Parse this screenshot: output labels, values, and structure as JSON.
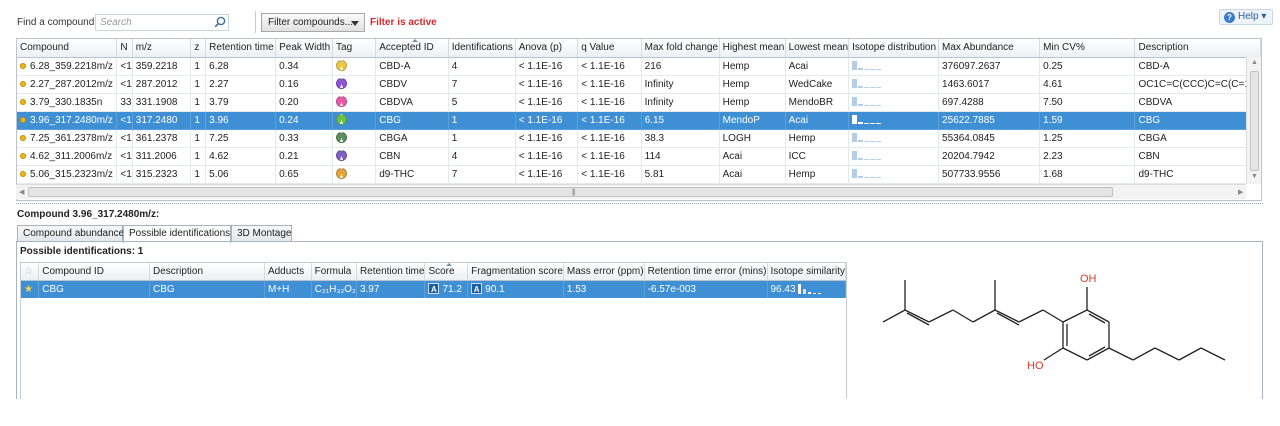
{
  "toolbar": {
    "find_label": "Find a compound:",
    "search_placeholder": "Search",
    "filter_button": "Filter compounds...",
    "filter_status": "Filter is active",
    "help": "Help"
  },
  "grid": {
    "columns": [
      "Compound",
      "N",
      "m/z",
      "z",
      "Retention time",
      "Peak Width",
      "Tag",
      "Accepted ID",
      "Identifications",
      "Anova (p)",
      "q Value",
      "Max fold change",
      "Highest mean",
      "Lowest mean",
      "Isotope distribution",
      "Max Abundance",
      "Min CV%",
      "Description"
    ],
    "rows": [
      {
        "compound": "6.28_359.2218m/z",
        "n": "<1",
        "mz": "359.2218",
        "z": "1",
        "rt": "6.28",
        "pw": "0.34",
        "tag_color": "#e9c94a",
        "accepted": "CBD-A",
        "ids": "4",
        "anova": "< 1.1E-16",
        "q": "< 1.1E-16",
        "fold": "216",
        "high": "Hemp",
        "low": "Acai",
        "maxab": "376097.2637",
        "cv": "0.25",
        "desc": "CBD-A"
      },
      {
        "compound": "2.27_287.2012m/z",
        "n": "<1",
        "mz": "287.2012",
        "z": "1",
        "rt": "2.27",
        "pw": "0.16",
        "tag_color": "#8d54d6",
        "accepted": "CBDV",
        "ids": "7",
        "anova": "< 1.1E-16",
        "q": "< 1.1E-16",
        "fold": "Infinity",
        "high": "Hemp",
        "low": "WedCake",
        "maxab": "1463.6017",
        "cv": "4.61",
        "desc": "OC1C=C(CCC)C=C(C=1[C"
      },
      {
        "compound": "3.79_330.1835n",
        "n": "33",
        "mz": "331.1908",
        "z": "1",
        "rt": "3.79",
        "pw": "0.20",
        "tag_color": "#e85aa8",
        "accepted": "CBDVA",
        "ids": "5",
        "anova": "< 1.1E-16",
        "q": "< 1.1E-16",
        "fold": "Infinity",
        "high": "Hemp",
        "low": "MendoBR",
        "maxab": "697.4288",
        "cv": "7.50",
        "desc": "CBDVA"
      },
      {
        "compound": "3.96_317.2480m/z",
        "n": "<1",
        "mz": "317.2480",
        "z": "1",
        "rt": "3.96",
        "pw": "0.24",
        "tag_color": "#6cc04a",
        "accepted": "CBG",
        "ids": "1",
        "anova": "< 1.1E-16",
        "q": "< 1.1E-16",
        "fold": "6.15",
        "high": "MendoP",
        "low": "Acai",
        "maxab": "25622.7885",
        "cv": "1.59",
        "desc": "CBG"
      },
      {
        "compound": "7.25_361.2378m/z",
        "n": "<1",
        "mz": "361.2378",
        "z": "1",
        "rt": "7.25",
        "pw": "0.33",
        "tag_color": "#5b8e5a",
        "accepted": "CBGA",
        "ids": "1",
        "anova": "< 1.1E-16",
        "q": "< 1.1E-16",
        "fold": "38.3",
        "high": "LOGH",
        "low": "Hemp",
        "maxab": "55364.0845",
        "cv": "1.25",
        "desc": "CBGA"
      },
      {
        "compound": "4.62_311.2006m/z",
        "n": "<1",
        "mz": "311.2006",
        "z": "1",
        "rt": "4.62",
        "pw": "0.21",
        "tag_color": "#7f5fc0",
        "accepted": "CBN",
        "ids": "4",
        "anova": "< 1.1E-16",
        "q": "< 1.1E-16",
        "fold": "114",
        "high": "Acai",
        "low": "ICC",
        "maxab": "20204.7942",
        "cv": "2.23",
        "desc": "CBN"
      },
      {
        "compound": "5.06_315.2323m/z",
        "n": "<1",
        "mz": "315.2323",
        "z": "1",
        "rt": "5.06",
        "pw": "0.65",
        "tag_color": "#e0a640",
        "accepted": "d9-THC",
        "ids": "7",
        "anova": "< 1.1E-16",
        "q": "< 1.1E-16",
        "fold": "5.81",
        "high": "Acai",
        "low": "Hemp",
        "maxab": "507733.9556",
        "cv": "1.68",
        "desc": "d9-THC"
      }
    ],
    "selected_row": 3
  },
  "detail": {
    "title": "Compound 3.96_317.2480m/z:",
    "tabs": [
      "Compound abundance",
      "Possible identifications",
      "3D Montage"
    ],
    "active_tab": 1,
    "possible_label": "Possible identifications: 1",
    "columns": [
      "Compound ID",
      "Description",
      "Adducts",
      "Formula",
      "Retention time",
      "Score",
      "Fragmentation score",
      "Mass error (ppm)",
      "Retention time error (mins)",
      "Isotope similarity"
    ],
    "row": {
      "compound_id": "CBG",
      "description": "CBG",
      "adducts": "M+H",
      "formula": "C₂₁H₃₂O₂",
      "rt": "3.97",
      "score_badge": "A",
      "score": "71.2",
      "frag_badge": "A",
      "frag": "90.1",
      "mass_error": "1.53",
      "rt_error": "-6.57e-003",
      "iso_sim": "96.43"
    },
    "structure": {
      "label_oh_top": "OH",
      "label_oh_bottom": "HO"
    }
  }
}
